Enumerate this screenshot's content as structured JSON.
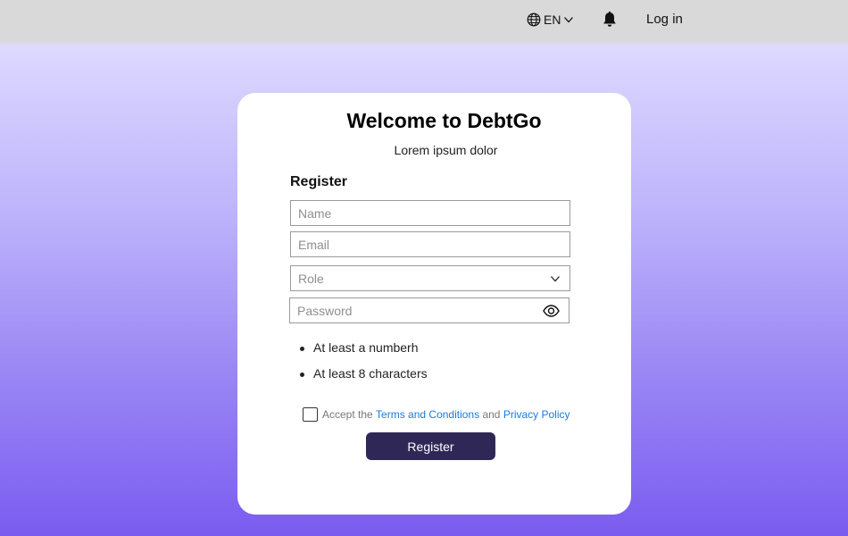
{
  "header": {
    "language_label": "EN",
    "login_label": "Log in"
  },
  "card": {
    "title": "Welcome to DebtGo",
    "subtitle": "Lorem ipsum dolor",
    "section_title": "Register",
    "fields": {
      "name_placeholder": "Name",
      "email_placeholder": "Email",
      "role_placeholder": "Role",
      "password_placeholder": "Password"
    },
    "password_rules": [
      "At least a numberh",
      "At least 8 characters"
    ],
    "terms": {
      "prefix": "Accept the",
      "terms_link": "Terms and Conditions",
      "conjunction": "and",
      "privacy_link": "Privacy Policy",
      "checked": false
    },
    "register_button": "Register"
  },
  "colors": {
    "topbar": "#d9d9d9",
    "button_bg": "#2f2857",
    "link": "#1a7be0",
    "gradient_top": "#e5e3ff",
    "gradient_bottom": "#7a5cf0"
  }
}
